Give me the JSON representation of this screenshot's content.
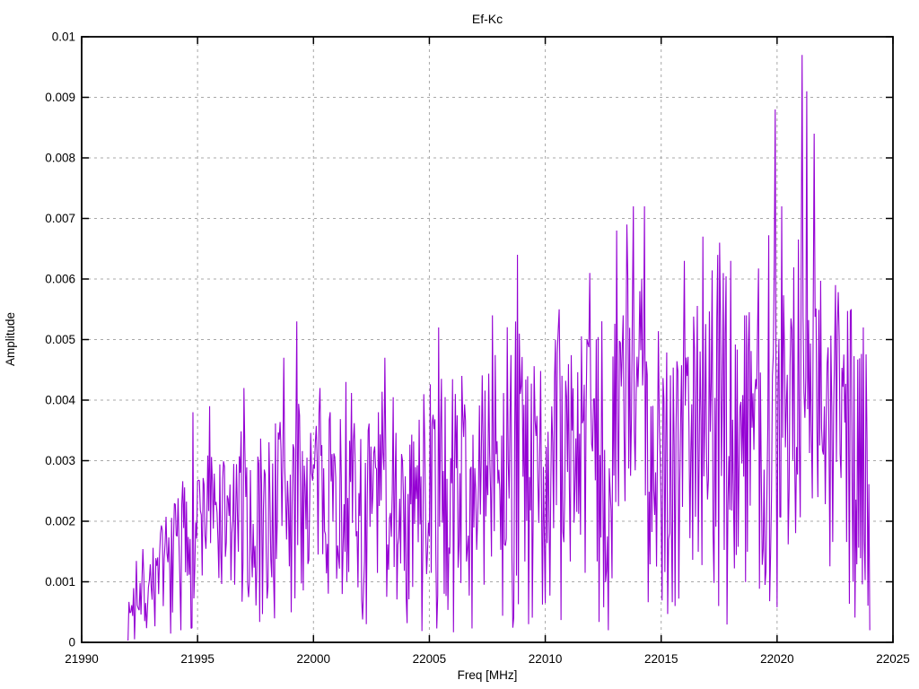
{
  "chart_data": {
    "type": "line",
    "title": "Ef-Kc",
    "xlabel": "Freq [MHz]",
    "ylabel": "Amplitude",
    "xlim": [
      21990,
      22025
    ],
    "ylim": [
      0,
      0.01
    ],
    "x_ticks": [
      21990,
      21995,
      22000,
      22005,
      22010,
      22015,
      22020,
      22025
    ],
    "x_tick_labels": [
      "21990",
      "21995",
      "22000",
      "22005",
      "22010",
      "22015",
      "22020",
      "22025"
    ],
    "y_ticks": [
      0,
      0.001,
      0.002,
      0.003,
      0.004,
      0.005,
      0.006,
      0.007,
      0.008,
      0.009,
      0.01
    ],
    "y_tick_labels": [
      "0",
      "0.001",
      "0.002",
      "0.003",
      "0.004",
      "0.005",
      "0.006",
      "0.007",
      "0.008",
      "0.009",
      "0.01"
    ],
    "grid": true,
    "grid_color": "#a8a8a8",
    "border_color": "#000000",
    "background_color": "#ffffff",
    "line_color": "#9400d3",
    "legend": "none",
    "series": [
      {
        "name": "Ef-Kc",
        "x_start": 21992.0,
        "x_end": 22024.0,
        "x_step": 0.04,
        "noise_seed": 7,
        "envelope": [
          [
            21992.0,
            0.0001,
            0.0006
          ],
          [
            21992.4,
            0.0003,
            0.0014
          ],
          [
            21993.0,
            0.0005,
            0.0016
          ],
          [
            21993.5,
            0.0007,
            0.0019
          ],
          [
            21994.0,
            0.0007,
            0.0022
          ],
          [
            21994.5,
            0.0006,
            0.0027
          ],
          [
            21995.0,
            0.0008,
            0.0031
          ],
          [
            21995.5,
            0.001,
            0.003
          ],
          [
            21996.0,
            0.0008,
            0.0028
          ],
          [
            21996.5,
            0.0006,
            0.003
          ],
          [
            21997.0,
            0.0008,
            0.0034
          ],
          [
            21997.5,
            0.0007,
            0.0033
          ],
          [
            21998.0,
            0.0008,
            0.0034
          ],
          [
            21998.5,
            0.0008,
            0.004
          ],
          [
            21999.0,
            0.0007,
            0.0043
          ],
          [
            21999.5,
            0.0008,
            0.0038
          ],
          [
            22000.0,
            0.001,
            0.004
          ],
          [
            22000.5,
            0.0008,
            0.0036
          ],
          [
            22001.0,
            0.0008,
            0.0038
          ],
          [
            22001.5,
            0.001,
            0.004
          ],
          [
            22002.0,
            0.0006,
            0.0036
          ],
          [
            22002.5,
            0.0008,
            0.0038
          ],
          [
            22003.0,
            0.0008,
            0.0042
          ],
          [
            22003.5,
            0.001,
            0.004
          ],
          [
            22004.0,
            0.0008,
            0.004
          ],
          [
            22004.5,
            0.0006,
            0.0038
          ],
          [
            22005.0,
            0.0008,
            0.004
          ],
          [
            22005.5,
            0.001,
            0.0044
          ],
          [
            22006.0,
            0.0008,
            0.0046
          ],
          [
            22006.5,
            0.001,
            0.0044
          ],
          [
            22007.0,
            0.0008,
            0.0042
          ],
          [
            22007.5,
            0.001,
            0.0046
          ],
          [
            22008.0,
            0.001,
            0.0048
          ],
          [
            22008.5,
            0.0008,
            0.0052
          ],
          [
            22009.0,
            0.0008,
            0.005
          ],
          [
            22009.5,
            0.0006,
            0.0044
          ],
          [
            22010.0,
            0.001,
            0.0048
          ],
          [
            22010.5,
            0.001,
            0.0052
          ],
          [
            22011.0,
            0.001,
            0.005
          ],
          [
            22011.5,
            0.0012,
            0.0052
          ],
          [
            22012.0,
            0.0008,
            0.005
          ],
          [
            22012.5,
            0.0006,
            0.0052
          ],
          [
            22013.0,
            0.001,
            0.0058
          ],
          [
            22013.5,
            0.0012,
            0.0062
          ],
          [
            22014.0,
            0.001,
            0.006
          ],
          [
            22014.5,
            0.0012,
            0.0058
          ],
          [
            22015.0,
            0.001,
            0.0056
          ],
          [
            22015.5,
            0.0012,
            0.0054
          ],
          [
            22016.0,
            0.0014,
            0.0058
          ],
          [
            22016.5,
            0.0012,
            0.006
          ],
          [
            22017.0,
            0.0012,
            0.0058
          ],
          [
            22017.5,
            0.001,
            0.0062
          ],
          [
            22018.0,
            0.0014,
            0.006
          ],
          [
            22018.5,
            0.0014,
            0.0058
          ],
          [
            22019.0,
            0.0016,
            0.006
          ],
          [
            22019.5,
            0.0016,
            0.0064
          ],
          [
            22020.0,
            0.0018,
            0.0068
          ],
          [
            22020.5,
            0.0016,
            0.0066
          ],
          [
            22021.0,
            0.0014,
            0.0068
          ],
          [
            22021.5,
            0.0016,
            0.0064
          ],
          [
            22022.0,
            0.0014,
            0.0058
          ],
          [
            22022.5,
            0.0012,
            0.0056
          ],
          [
            22023.0,
            0.0018,
            0.0054
          ],
          [
            22023.5,
            0.0014,
            0.0052
          ],
          [
            22024.0,
            0.0002,
            0.0045
          ]
        ],
        "peaks": [
          [
            21994.8,
            0.0038
          ],
          [
            21995.5,
            0.0039
          ],
          [
            21997.0,
            0.0042
          ],
          [
            21998.7,
            0.0047
          ],
          [
            21999.3,
            0.0053
          ],
          [
            22000.3,
            0.0042
          ],
          [
            22001.4,
            0.0043
          ],
          [
            22003.1,
            0.0047
          ],
          [
            22005.4,
            0.0052
          ],
          [
            22007.7,
            0.0054
          ],
          [
            22008.8,
            0.0064
          ],
          [
            22010.6,
            0.0055
          ],
          [
            22011.9,
            0.0061
          ],
          [
            22013.1,
            0.0068
          ],
          [
            22013.5,
            0.0069
          ],
          [
            22013.8,
            0.0072
          ],
          [
            22014.3,
            0.0072
          ],
          [
            22016.0,
            0.0063
          ],
          [
            22016.8,
            0.0067
          ],
          [
            22017.5,
            0.0066
          ],
          [
            22018.0,
            0.0063
          ],
          [
            22019.9,
            0.0088
          ],
          [
            22020.2,
            0.0072
          ],
          [
            22021.1,
            0.0097
          ],
          [
            22021.3,
            0.0091
          ],
          [
            22021.6,
            0.0084
          ],
          [
            22022.5,
            0.0059
          ],
          [
            22023.2,
            0.0055
          ],
          [
            22023.7,
            0.0052
          ]
        ],
        "dips": [
          [
            21992.3,
            5e-05
          ],
          [
            21994.3,
            0.0002
          ],
          [
            22002.3,
            0.0003
          ],
          [
            22009.3,
            0.0003
          ],
          [
            22012.7,
            0.0002
          ],
          [
            22015.6,
            0.0006
          ],
          [
            22024.0,
            0.0002
          ]
        ]
      }
    ]
  }
}
